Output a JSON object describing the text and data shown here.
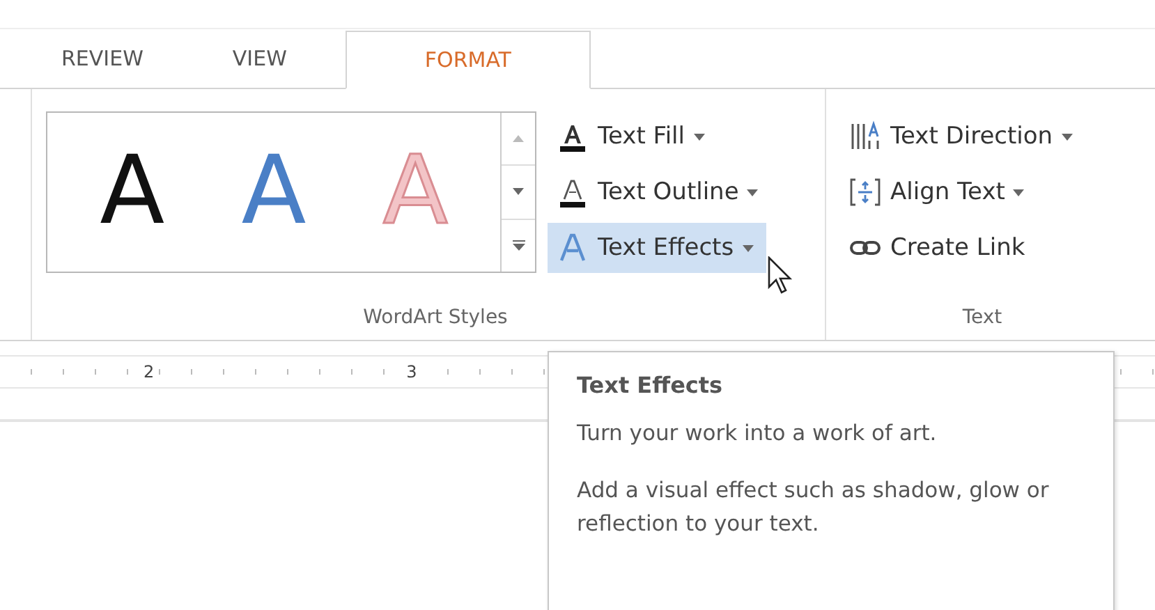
{
  "tabs": [
    {
      "label": "REVIEW",
      "selected": false
    },
    {
      "label": "VIEW",
      "selected": false
    },
    {
      "label": "FORMAT",
      "selected": true
    }
  ],
  "wordart_group": {
    "label": "WordArt Styles",
    "styles": [
      {
        "preview": "A",
        "kind": "fill",
        "color": "#111111"
      },
      {
        "preview": "A",
        "kind": "fill",
        "color": "#4a7fc6"
      },
      {
        "preview": "A",
        "kind": "outline",
        "color": "#f3c4c7"
      }
    ],
    "commands": [
      {
        "label": "Text Fill",
        "dropdown": true,
        "highlighted": false
      },
      {
        "label": "Text Outline",
        "dropdown": true,
        "highlighted": false
      },
      {
        "label": "Text Effects",
        "dropdown": true,
        "highlighted": true
      }
    ]
  },
  "text_group": {
    "label": "Text",
    "commands": [
      {
        "label": "Text Direction",
        "dropdown": true,
        "highlighted": false
      },
      {
        "label": "Align Text",
        "dropdown": true,
        "highlighted": false
      },
      {
        "label": "Create Link",
        "dropdown": false,
        "highlighted": false
      }
    ]
  },
  "ruler": {
    "numbers": [
      "2",
      "3"
    ]
  },
  "tooltip": {
    "title": "Text Effects",
    "description": "Turn your work into a work of art.",
    "detail": "Add a visual effect such as shadow, glow or reflection to your text."
  }
}
